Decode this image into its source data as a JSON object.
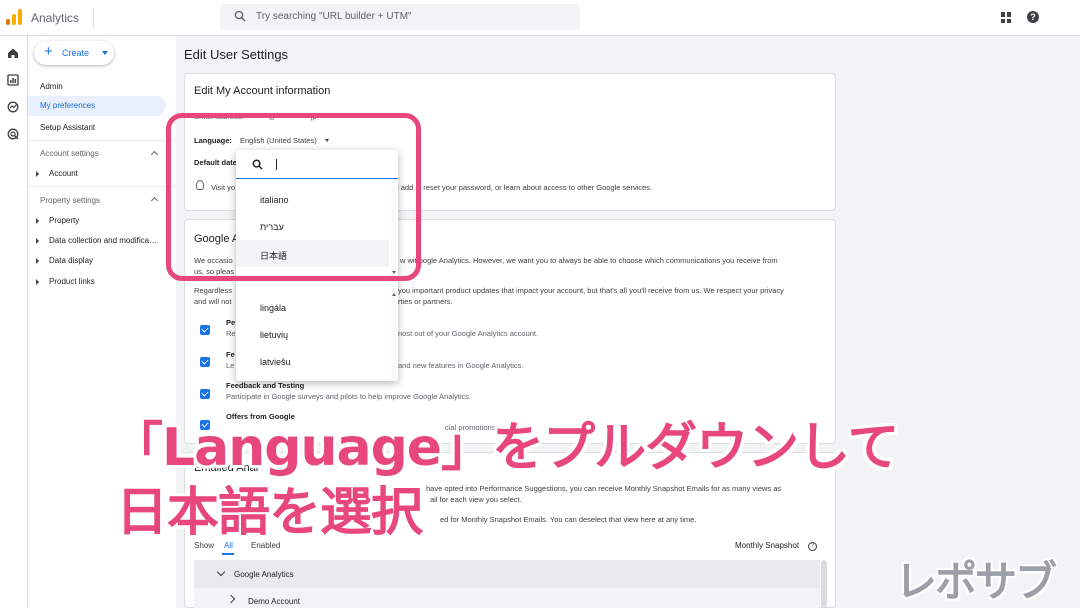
{
  "topbar": {
    "app_name": "Analytics",
    "search_placeholder": "Try searching \"URL builder + UTM\""
  },
  "sidebar": {
    "create_label": "Create",
    "items": [
      "Admin",
      "My preferences",
      "Setup Assistant"
    ],
    "account_settings": {
      "header": "Account settings",
      "items": [
        "Account"
      ]
    },
    "property_settings": {
      "header": "Property settings",
      "items": [
        "Property",
        "Data collection and modifica…",
        "Data display",
        "Product links"
      ]
    }
  },
  "main": {
    "page_title": "Edit User Settings",
    "account_card": {
      "title": "Edit My Account information",
      "email_label_partial": "Email address: ·········@··············jp",
      "language_label": "Language:",
      "language_value": "English (United States)",
      "default_date_label": "Default date",
      "visit_text_start": "Visit yo",
      "visit_text_end": "l add  s, reset your password, or learn about access to other Google services."
    },
    "google_card": {
      "title_partial": "Google A",
      "para1_line1_start": "We occasio",
      "para1_line1_end": "w wit  oogle Analytics. However, we want you to always be able to choose which communications you receive from",
      "para1_line2": "us, so pleas",
      "para2_line1_start": "Regardless",
      "para2_line1_end": "you important product updates that impact your account, but that's all you'll receive from us. We respect your privacy",
      "para2_line2_start": "and will not",
      "para2_line2_end": "rties or partners.",
      "options": [
        {
          "title": "Pe",
          "desc_start": "Re",
          "desc_end": "nost out of your Google Analytics account."
        },
        {
          "title": "Fe",
          "desc_start": "Le",
          "desc_end": "and new features in Google Analytics."
        },
        {
          "title": "Feedback and Testing",
          "desc_start": "Participate in Google surveys and pilots to help improve Google Analytics.",
          "desc_end": ""
        },
        {
          "title": "Offers from Google",
          "desc_start": "",
          "desc_end": "cial promotions."
        }
      ]
    },
    "email_card": {
      "title_partial": "Emailed Anal",
      "line1_end": "have opted into Performance Suggestions, you can receive Monthly Snapshot Emails for as many views as",
      "line2_end": "ail for each view you select.",
      "line3_end": "ed for Monthly Snapshot Emails. You can deselect that view here at any time."
    },
    "tabs": {
      "show_label": "Show",
      "all": "All",
      "enabled": "Enabled",
      "monthly_snapshot": "Monthly Snapshot"
    },
    "table": {
      "group": "Google Analytics",
      "child": "Demo Account"
    }
  },
  "dropdown": {
    "options": [
      "italiano",
      "עברית",
      "日本語",
      "lingála",
      "lietuvių",
      "latviešu"
    ],
    "selected": "日本語"
  },
  "captions": {
    "line1": "「Language」をプルダウンして",
    "line2": "日本語を選択",
    "watermark": "レポサブ"
  },
  "colors": {
    "accent": "#1a73e8",
    "highlight": "#e8477c",
    "logo_orange": "#f9ab00",
    "logo_dark_orange": "#e37400"
  }
}
